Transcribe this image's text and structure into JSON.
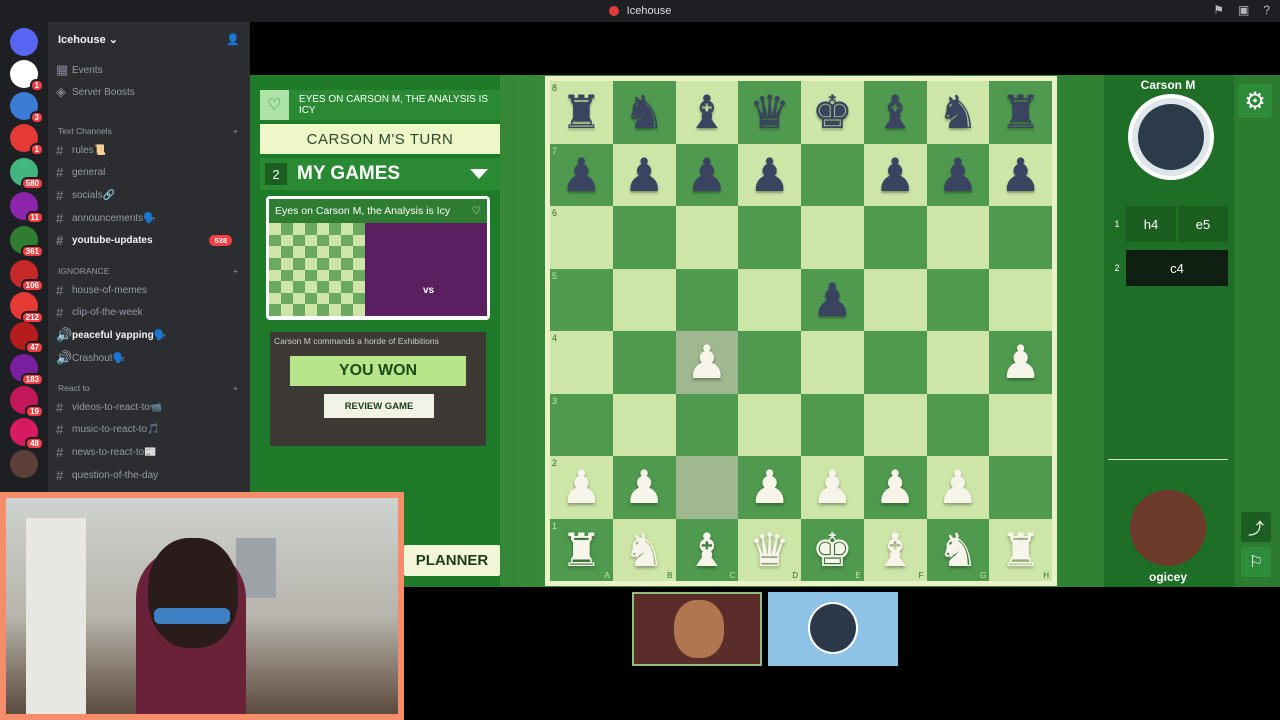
{
  "window": {
    "title": "Icehouse"
  },
  "server": {
    "name": "Icehouse"
  },
  "guild_badges": [
    "1",
    "3",
    "1",
    "580",
    "11",
    "361",
    "106",
    "212",
    "47",
    "183",
    "19",
    "48"
  ],
  "sidebar": {
    "top_items": [
      {
        "label": "Events",
        "icon": "calendar-icon"
      },
      {
        "label": "Server Boosts",
        "icon": "boost-icon"
      }
    ],
    "categories": [
      {
        "label": "Text Channels"
      },
      {
        "label": "IGNORANCE"
      },
      {
        "label": "React to"
      }
    ],
    "text_channels": [
      {
        "label": "rules📜"
      },
      {
        "label": "general"
      },
      {
        "label": "socials🔗"
      },
      {
        "label": "announcements🗣️"
      },
      {
        "label": "youtube-updates",
        "badge": "538"
      }
    ],
    "ignorance_channels": [
      {
        "label": "house-of-memes"
      },
      {
        "label": "clip-of-the-week"
      },
      {
        "label": "peaceful yapping🗣️"
      },
      {
        "label": "Crashout🗣️"
      }
    ],
    "react_channels": [
      {
        "label": "videos-to-react-to📹"
      },
      {
        "label": "music-to-react-to🎵"
      },
      {
        "label": "news-to-react-to📰"
      },
      {
        "label": "question-of-the-day"
      }
    ]
  },
  "game": {
    "title_banner": "EYES ON CARSON M, THE ANALYSIS IS ICY",
    "turn": "CARSON M'S TURN",
    "my_games_count": "2",
    "my_games_label": "MY GAMES",
    "card1_title": "Eyes on Carson M, the Analysis is Icy",
    "card1_vs": "vs",
    "card2_title": "Carson M commands a horde of Exhibitions",
    "won_text": "YOU WON",
    "review_label": "REVIEW GAME",
    "planner_label": "PLANNER"
  },
  "board": {
    "ranks": [
      "8",
      "7",
      "6",
      "5",
      "4",
      "3",
      "2",
      "1"
    ],
    "files": [
      "A",
      "B",
      "C",
      "D",
      "E",
      "F",
      "G",
      "H"
    ],
    "rows": [
      [
        "b:♜",
        "b:♞",
        "b:♝",
        "b:♛",
        "b:♚",
        "b:♝",
        "b:♞",
        "b:♜"
      ],
      [
        "b:♟",
        "b:♟",
        "b:♟",
        "b:♟",
        "",
        "b:♟",
        "b:♟",
        "b:♟"
      ],
      [
        "",
        "",
        "",
        "",
        "",
        "",
        "",
        ""
      ],
      [
        "",
        "",
        "",
        "",
        "b:♟",
        "",
        "",
        ""
      ],
      [
        "",
        "",
        "w:♟",
        "",
        "",
        "",
        "",
        "w:♟"
      ],
      [
        "",
        "",
        "",
        "",
        "",
        "",
        "",
        ""
      ],
      [
        "w:♟",
        "w:♟",
        "",
        "w:♟",
        "w:♟",
        "w:♟",
        "w:♟",
        ""
      ],
      [
        "w:♜",
        "w:♞",
        "w:♝",
        "w:♛",
        "w:♚",
        "w:♝",
        "w:♞",
        "w:♜"
      ]
    ],
    "highlighted": [
      "4-2",
      "6-2"
    ]
  },
  "players": {
    "opponent": "Carson M",
    "me": "ogicey"
  },
  "moves": [
    {
      "no": "1",
      "white": "h4",
      "black": "e5"
    },
    {
      "no": "2",
      "white": "c4"
    }
  ]
}
